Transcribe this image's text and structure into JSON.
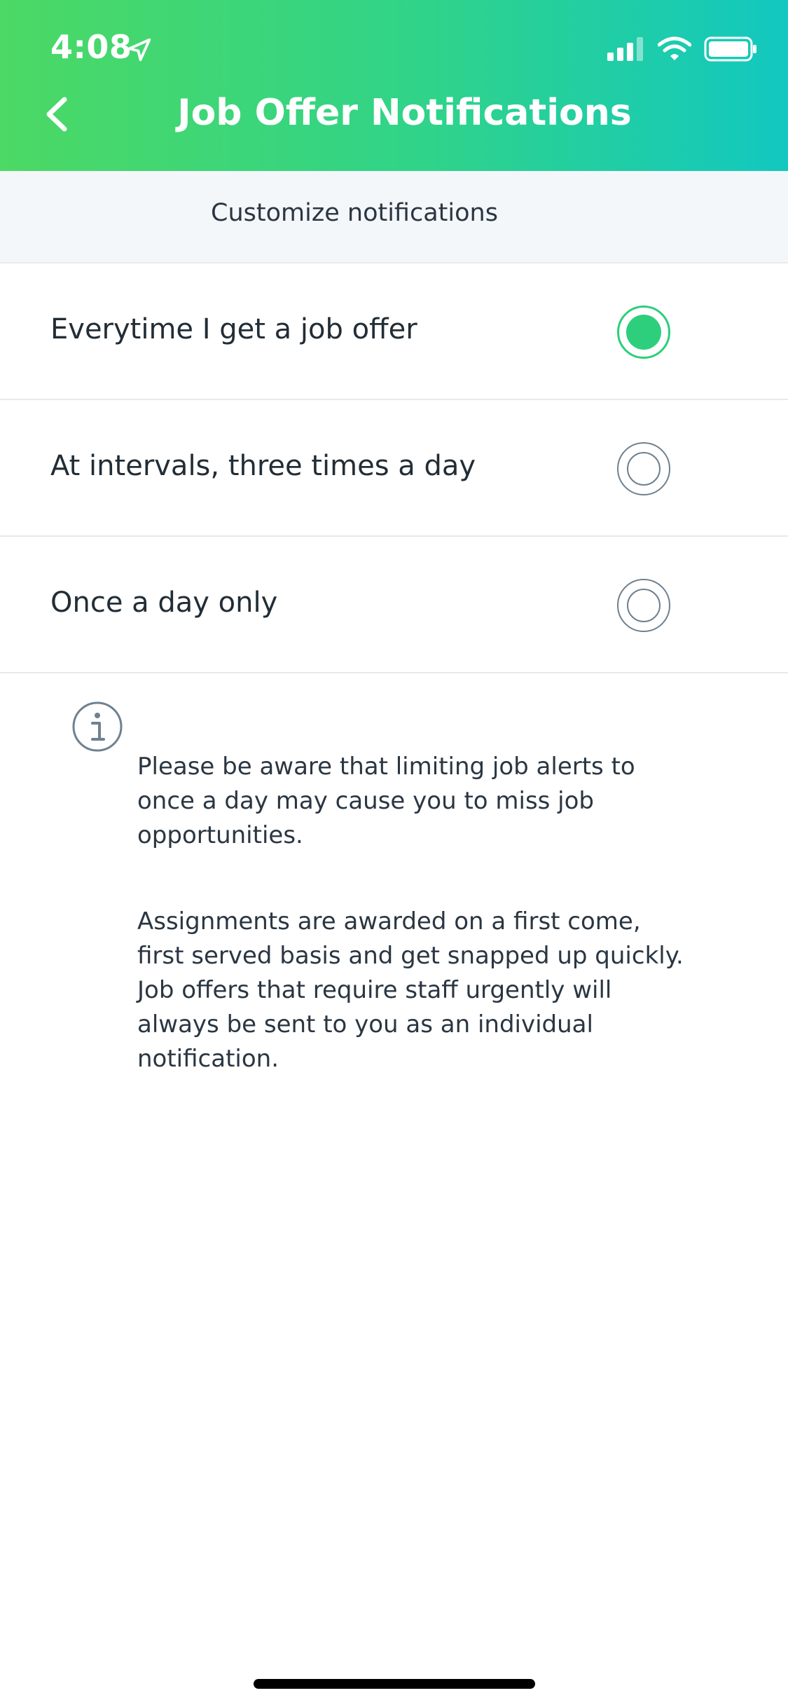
{
  "status_bar": {
    "time": "4:08"
  },
  "nav": {
    "title": "Job Offer Notifications"
  },
  "section": {
    "header": "Customize notifications"
  },
  "options": [
    {
      "label": "Everytime I get a job offer",
      "selected": true
    },
    {
      "label": "At intervals, three times a day",
      "selected": false
    },
    {
      "label": "Once a day only",
      "selected": false
    }
  ],
  "info": {
    "paragraph_1": "Please be aware that limiting job alerts to once a day may cause you to miss job opportunities.",
    "paragraph_2": "Assignments are awarded on a first come, first served basis and get snapped up quickly. Job offers that require staff urgently will always be sent to you as an individual notification."
  },
  "colors": {
    "header_gradient_start": "#4cd964",
    "header_gradient_end": "#12c8c0",
    "accent": "#2dcf7d"
  },
  "icons": {
    "back": "chevron-left-icon",
    "location": "location-arrow-icon",
    "signal": "signal-icon",
    "wifi": "wifi-icon",
    "battery": "battery-icon",
    "info": "info-icon"
  }
}
